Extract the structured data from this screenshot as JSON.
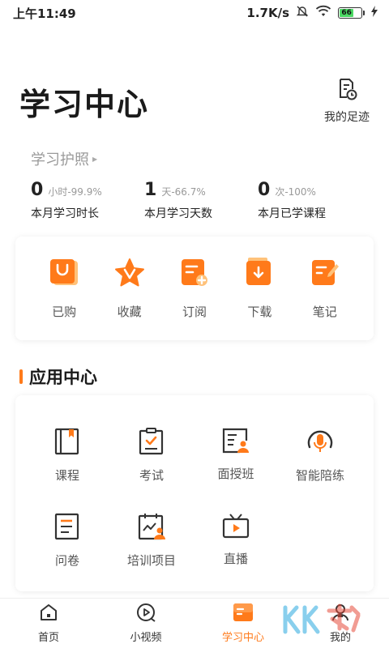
{
  "status_bar": {
    "time": "上午11:49",
    "network_speed": "1.7K/s",
    "battery_level": "66"
  },
  "header": {
    "title": "学习中心",
    "footprint_label": "我的足迹",
    "footprint_icon": "footprint-clock-icon"
  },
  "passport": {
    "label": "学习护照"
  },
  "stats": [
    {
      "value": "0",
      "sub": "小时-99.9%",
      "label": "本月学习时长"
    },
    {
      "value": "1",
      "sub": "天-66.7%",
      "label": "本月学习天数"
    },
    {
      "value": "0",
      "sub": "次-100%",
      "label": "本月已学课程"
    }
  ],
  "quick_actions": [
    {
      "label": "已购",
      "icon": "shopping-bag-icon"
    },
    {
      "label": "收藏",
      "icon": "star-icon"
    },
    {
      "label": "订阅",
      "icon": "subscribe-icon"
    },
    {
      "label": "下载",
      "icon": "download-icon"
    },
    {
      "label": "笔记",
      "icon": "note-icon"
    }
  ],
  "app_center": {
    "title": "应用中心",
    "items": [
      {
        "label": "课程",
        "icon": "book-icon"
      },
      {
        "label": "考试",
        "icon": "exam-clipboard-icon"
      },
      {
        "label": "面授班",
        "icon": "classroom-icon"
      },
      {
        "label": "智能陪练",
        "icon": "microphone-icon"
      },
      {
        "label": "问卷",
        "icon": "questionnaire-icon"
      },
      {
        "label": "培训项目",
        "icon": "training-project-icon"
      },
      {
        "label": "直播",
        "icon": "live-tv-icon"
      }
    ]
  },
  "bottom_nav": [
    {
      "label": "首页",
      "icon": "home-icon",
      "active": false
    },
    {
      "label": "小视频",
      "icon": "play-circle-icon",
      "active": false
    },
    {
      "label": "学习中心",
      "icon": "study-center-icon",
      "active": true
    },
    {
      "label": "我的",
      "icon": "user-icon",
      "active": false
    }
  ],
  "colors": {
    "accent": "#ff7a1a",
    "accent_light": "#ffb05a",
    "text_dark": "#1a1a1a",
    "text_muted": "#999999"
  }
}
